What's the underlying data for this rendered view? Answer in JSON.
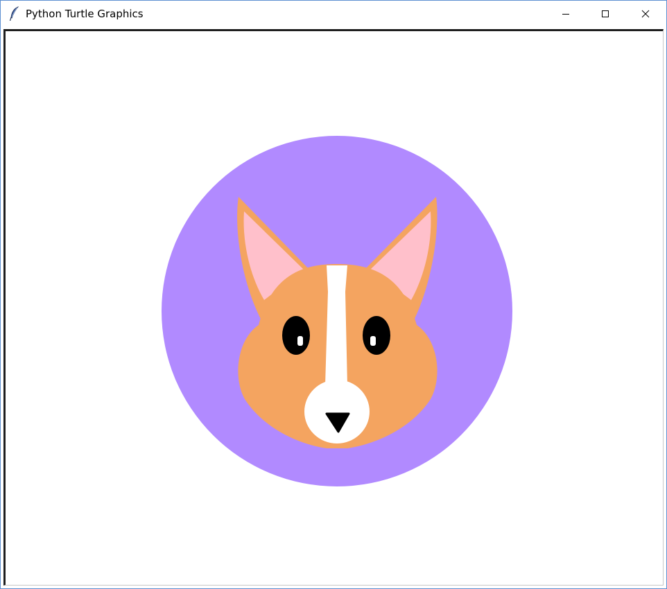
{
  "window": {
    "title": "Python Turtle Graphics",
    "app_icon": "feather-icon",
    "controls": {
      "minimize": "minimize-icon",
      "maximize": "maximize-icon",
      "close": "close-icon"
    }
  },
  "canvas": {
    "background": "#ffffff",
    "drawing": {
      "subject": "corgi-face",
      "colors": {
        "circle": "#b18aff",
        "fur": "#f4a460",
        "inner_ear": "#ffc0cb",
        "blaze": "#ffffff",
        "eyes": "#000000",
        "nose": "#000000",
        "highlight": "#ffffff"
      }
    }
  }
}
